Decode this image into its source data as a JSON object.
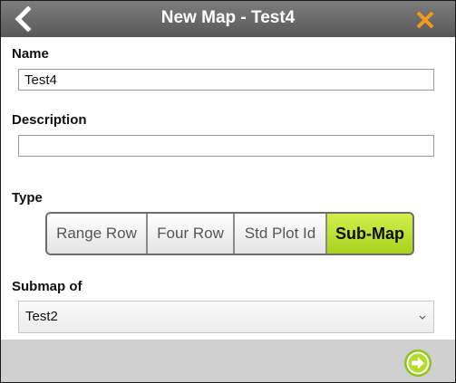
{
  "header": {
    "title": "New Map - Test4",
    "back_icon": "chevron-left-icon",
    "close_icon": "close-icon"
  },
  "form": {
    "name_label": "Name",
    "name_value": "Test4",
    "description_label": "Description",
    "description_value": "",
    "type_label": "Type",
    "type_options": [
      "Range Row",
      "Four Row",
      "Std Plot Id",
      "Sub-Map"
    ],
    "type_selected": "Sub-Map",
    "submap_label": "Submap of",
    "submap_value": "Test2"
  },
  "footer": {
    "next_icon": "arrow-right-circle-icon"
  },
  "colors": {
    "accent": "#a8d21e",
    "close": "#f39a1e",
    "header": "#6a6a6a"
  }
}
